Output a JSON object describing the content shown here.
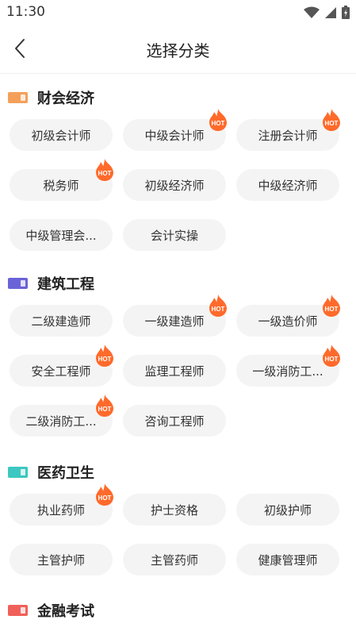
{
  "status_bar": {
    "time": "11:30"
  },
  "header": {
    "title": "选择分类"
  },
  "hot_text": "HOT",
  "sections": [
    {
      "title": "财会经济",
      "icon_color": "#f4a05a",
      "items": [
        {
          "label": "初级会计师",
          "hot": false
        },
        {
          "label": "中级会计师",
          "hot": true
        },
        {
          "label": "注册会计师",
          "hot": true
        },
        {
          "label": "税务师",
          "hot": true
        },
        {
          "label": "初级经济师",
          "hot": false
        },
        {
          "label": "中级经济师",
          "hot": false
        },
        {
          "label": "中级管理会...",
          "hot": false
        },
        {
          "label": "会计实操",
          "hot": false
        }
      ]
    },
    {
      "title": "建筑工程",
      "icon_color": "#6a63d8",
      "items": [
        {
          "label": "二级建造师",
          "hot": false
        },
        {
          "label": "一级建造师",
          "hot": true
        },
        {
          "label": "一级造价师",
          "hot": true
        },
        {
          "label": "安全工程师",
          "hot": true
        },
        {
          "label": "监理工程师",
          "hot": false
        },
        {
          "label": "一级消防工...",
          "hot": true
        },
        {
          "label": "二级消防工...",
          "hot": true
        },
        {
          "label": "咨询工程师",
          "hot": false
        }
      ]
    },
    {
      "title": "医药卫生",
      "icon_color": "#3cc8c0",
      "items": [
        {
          "label": "执业药师",
          "hot": true
        },
        {
          "label": "护士资格",
          "hot": false
        },
        {
          "label": "初级护师",
          "hot": false
        },
        {
          "label": "主管护师",
          "hot": false
        },
        {
          "label": "主管药师",
          "hot": false
        },
        {
          "label": "健康管理师",
          "hot": false
        }
      ]
    },
    {
      "title": "金融考试",
      "icon_color": "#f0605a",
      "items": []
    }
  ]
}
